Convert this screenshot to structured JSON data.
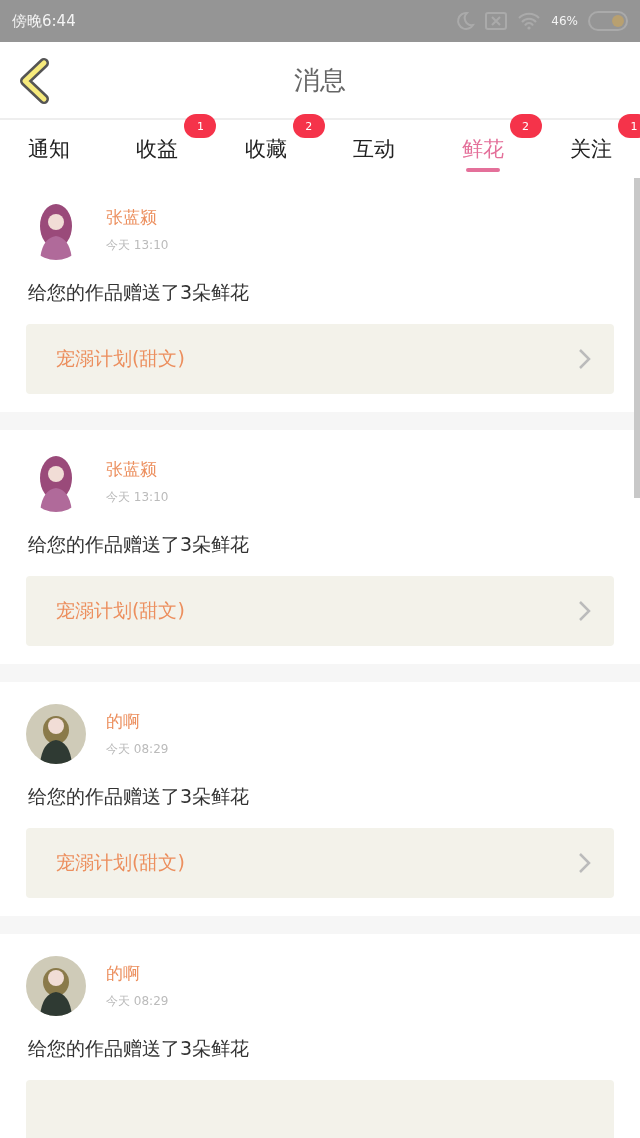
{
  "status_bar": {
    "time": "傍晚6:44",
    "battery": "46%"
  },
  "header": {
    "title": "消息"
  },
  "tabs": [
    {
      "label": "通知",
      "selected": false
    },
    {
      "label": "收益",
      "selected": false,
      "badge": "1"
    },
    {
      "label": "收藏",
      "selected": false,
      "badge": "2"
    },
    {
      "label": "互动",
      "selected": false
    },
    {
      "label": "鲜花",
      "selected": true,
      "badge": "2"
    },
    {
      "label": "关注",
      "selected": false,
      "badge": "1"
    }
  ],
  "messages": [
    {
      "name": "张蓝颍",
      "time": "今天 13:10",
      "text": "给您的作品赠送了3朵鲜花",
      "work": "宠溺计划(甜文)"
    },
    {
      "name": "张蓝颍",
      "time": "今天 13:10",
      "text": "给您的作品赠送了3朵鲜花",
      "work": "宠溺计划(甜文)"
    },
    {
      "name": "的啊",
      "time": "今天 08:29",
      "text": "给您的作品赠送了3朵鲜花",
      "work": "宠溺计划(甜文)"
    },
    {
      "name": "的啊",
      "time": "今天 08:29",
      "text": "给您的作品赠送了3朵鲜花"
    }
  ]
}
